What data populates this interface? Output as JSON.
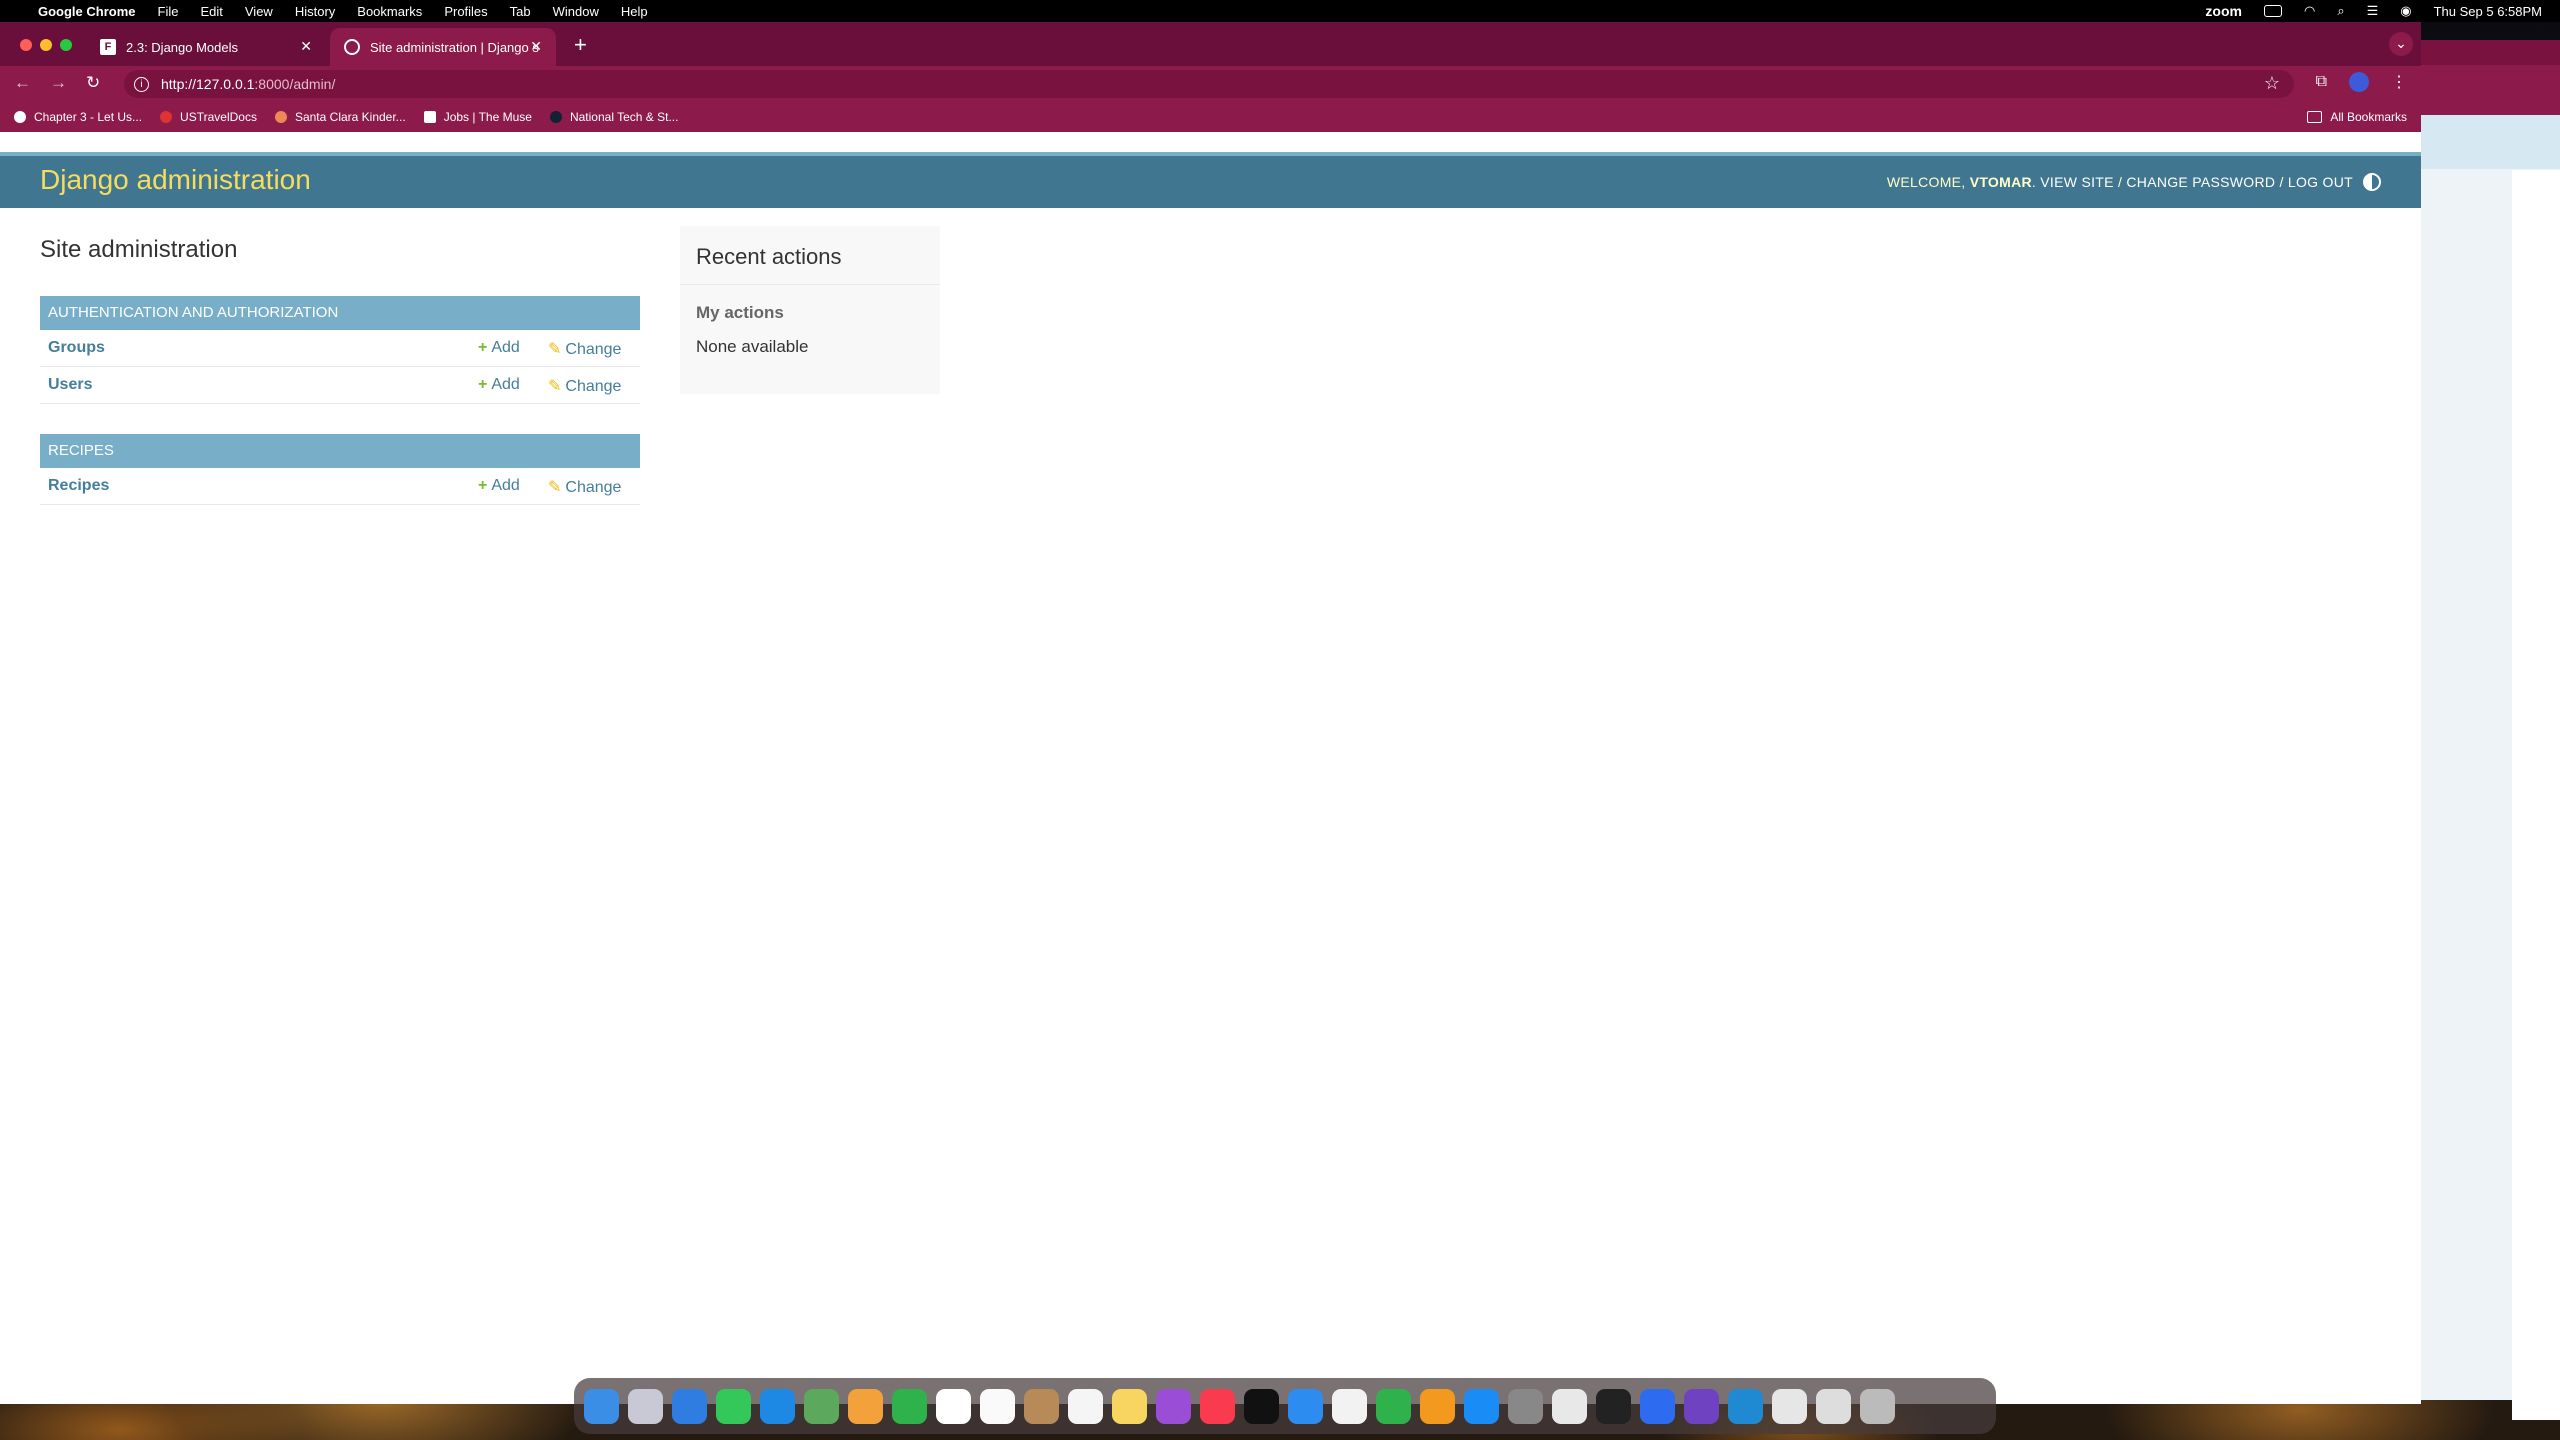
{
  "menubar": {
    "app_name": "Google Chrome",
    "menus": [
      "File",
      "Edit",
      "View",
      "History",
      "Bookmarks",
      "Profiles",
      "Tab",
      "Window",
      "Help"
    ],
    "status_app": "zoom",
    "datetime": "Thu Sep 5  6:58PM"
  },
  "browser": {
    "tabs": [
      {
        "title": "2.3: Django Models",
        "favicon": "F"
      },
      {
        "title": "Site administration | Django s"
      }
    ],
    "url_host": "http://127.0.0.1",
    "url_rest": ":8000/admin/",
    "bookmarks": [
      {
        "label": "Chapter 3 - Let Us..."
      },
      {
        "label": "USTravelDocs"
      },
      {
        "label": "Santa Clara Kinder..."
      },
      {
        "label": "Jobs | The Muse"
      },
      {
        "label": "National Tech & St..."
      }
    ],
    "all_bookmarks": "All Bookmarks"
  },
  "django": {
    "brand": "Django administration",
    "welcome": "WELCOME, ",
    "username": "VTOMAR",
    "view_site": "VIEW SITE",
    "change_password": "CHANGE PASSWORD",
    "log_out": "LOG OUT",
    "sep": " / ",
    "page_title": "Site administration",
    "add_label": "Add",
    "change_label": "Change",
    "apps": [
      {
        "caption": "AUTHENTICATION AND AUTHORIZATION",
        "models": [
          "Groups",
          "Users"
        ]
      },
      {
        "caption": "RECIPES",
        "models": [
          "Recipes"
        ]
      }
    ],
    "recent_actions": {
      "title": "Recent actions",
      "subtitle": "My actions",
      "empty": "None available"
    }
  },
  "colors": {
    "header": "#417690",
    "brand_text": "#f5dd5d",
    "caption": "#79aec8",
    "link": "#447e9b",
    "chrome_tabstrip": "#6a0f3c",
    "chrome_toolbar": "#8c1a4a"
  }
}
